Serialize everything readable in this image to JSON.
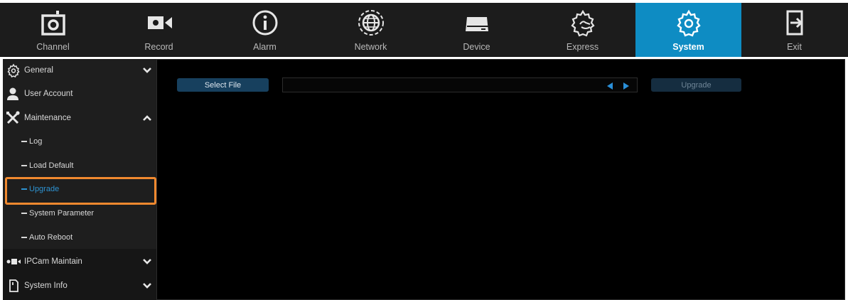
{
  "topnav": {
    "items": [
      {
        "label": "Channel",
        "icon": "camera-icon"
      },
      {
        "label": "Record",
        "icon": "video-camera-icon"
      },
      {
        "label": "Alarm",
        "icon": "info-alarm-icon"
      },
      {
        "label": "Network",
        "icon": "globe-icon"
      },
      {
        "label": "Device",
        "icon": "hard-drive-icon"
      },
      {
        "label": "Express",
        "icon": "gear-hand-icon"
      },
      {
        "label": "System",
        "icon": "gear-icon"
      },
      {
        "label": "Exit",
        "icon": "exit-icon"
      }
    ],
    "active": "System"
  },
  "sidebar": {
    "sections": [
      {
        "label": "General",
        "icon": "gear-icon",
        "state": "collapsed"
      },
      {
        "label": "User Account",
        "icon": "user-icon"
      },
      {
        "label": "Maintenance",
        "icon": "tools-icon",
        "state": "expanded"
      }
    ],
    "maintenance_items": [
      {
        "label": "Log"
      },
      {
        "label": "Load Default"
      },
      {
        "label": "Upgrade",
        "active": true
      },
      {
        "label": "System Parameter"
      },
      {
        "label": "Auto Reboot"
      }
    ],
    "bottom_sections": [
      {
        "label": "IPCam Maintain",
        "icon": "ipcam-icon",
        "state": "collapsed"
      },
      {
        "label": "System Info",
        "icon": "document-icon",
        "state": "collapsed"
      }
    ]
  },
  "main": {
    "select_file_label": "Select File",
    "file_path": "",
    "upgrade_label": "Upgrade"
  },
  "colors": {
    "accent": "#0e8cc3",
    "active_text": "#2d93d2",
    "highlight": "#f0892f",
    "button": "#17405e"
  }
}
